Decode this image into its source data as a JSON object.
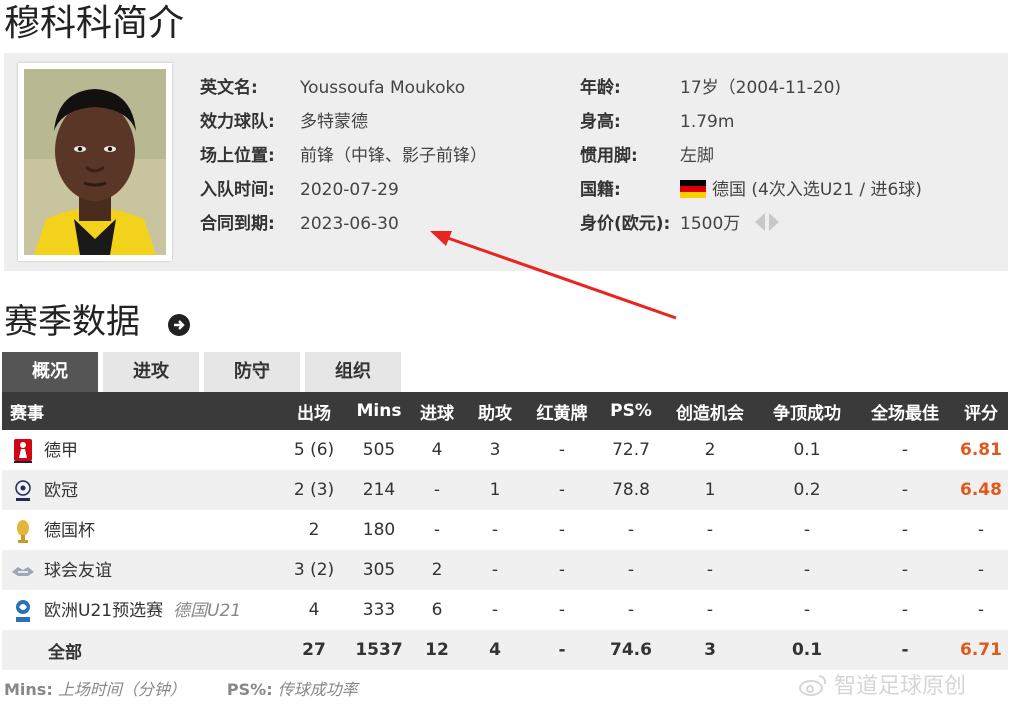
{
  "page_title": "穆科科简介",
  "profile": {
    "left": [
      {
        "label": "英文名:",
        "value": "Youssoufa Moukoko"
      },
      {
        "label": "效力球队:",
        "value": "多特蒙德"
      },
      {
        "label": "场上位置:",
        "value": "前锋（中锋、影子前锋）"
      },
      {
        "label": "入队时间:",
        "value": "2020-07-29"
      },
      {
        "label": "合同到期:",
        "value": "2023-06-30"
      }
    ],
    "right": [
      {
        "label": "年龄:",
        "value": "17岁（2004-11-20)"
      },
      {
        "label": "身高:",
        "value": "1.79m"
      },
      {
        "label": "惯用脚:",
        "value": "左脚"
      },
      {
        "label": "国籍:",
        "value": "德国 (4次入选U21 / 进6球)"
      },
      {
        "label": "身价(欧元):",
        "value": "1500万"
      }
    ],
    "flag_colors": [
      "#000000",
      "#dd0000",
      "#ffce00"
    ]
  },
  "season": {
    "title": "赛季数据",
    "tabs": [
      "概况",
      "进攻",
      "防守",
      "组织"
    ],
    "headers": [
      "赛事",
      "出场",
      "Mins",
      "进球",
      "助攻",
      "红黄牌",
      "PS%",
      "创造机会",
      "争顶成功",
      "全场最佳",
      "评分"
    ],
    "rows": [
      {
        "comp": "德甲",
        "icon": "bundesliga-icon",
        "note": "",
        "apps": "5 (6)",
        "mins": "505",
        "goals": "4",
        "assists": "3",
        "cards": "-",
        "ps": "72.7",
        "chances": "2",
        "aerials": "0.1",
        "motm": "-",
        "rating": "6.81"
      },
      {
        "comp": "欧冠",
        "icon": "champions-league-icon",
        "note": "",
        "apps": "2 (3)",
        "mins": "214",
        "goals": "-",
        "assists": "1",
        "cards": "-",
        "ps": "78.8",
        "chances": "1",
        "aerials": "0.2",
        "motm": "-",
        "rating": "6.48"
      },
      {
        "comp": "德国杯",
        "icon": "dfb-pokal-icon",
        "note": "",
        "apps": "2",
        "mins": "180",
        "goals": "-",
        "assists": "-",
        "cards": "-",
        "ps": "-",
        "chances": "-",
        "aerials": "-",
        "motm": "-",
        "rating": "-"
      },
      {
        "comp": "球会友谊",
        "icon": "handshake-icon",
        "note": "",
        "apps": "3 (2)",
        "mins": "305",
        "goals": "2",
        "assists": "-",
        "cards": "-",
        "ps": "-",
        "chances": "-",
        "aerials": "-",
        "motm": "-",
        "rating": "-"
      },
      {
        "comp": "欧洲U21预选赛",
        "icon": "uefa-u21-icon",
        "note": "德国U21",
        "apps": "4",
        "mins": "333",
        "goals": "6",
        "assists": "-",
        "cards": "-",
        "ps": "-",
        "chances": "-",
        "aerials": "-",
        "motm": "-",
        "rating": "-"
      }
    ],
    "total": {
      "comp": "全部",
      "apps": "27",
      "mins": "1537",
      "goals": "12",
      "assists": "4",
      "cards": "-",
      "ps": "74.6",
      "chances": "3",
      "aerials": "0.1",
      "motm": "-",
      "rating": "6.71"
    }
  },
  "footnote": {
    "k1": "Mins:",
    "v1": "上场时间（分钟）",
    "k2": "PS%:",
    "v2": "传球成功率"
  },
  "watermark": "智道足球原创",
  "colors": {
    "rating": "#e0591b",
    "header_bg": "#3a3a3a",
    "annotation_arrow": "#e8251f"
  }
}
